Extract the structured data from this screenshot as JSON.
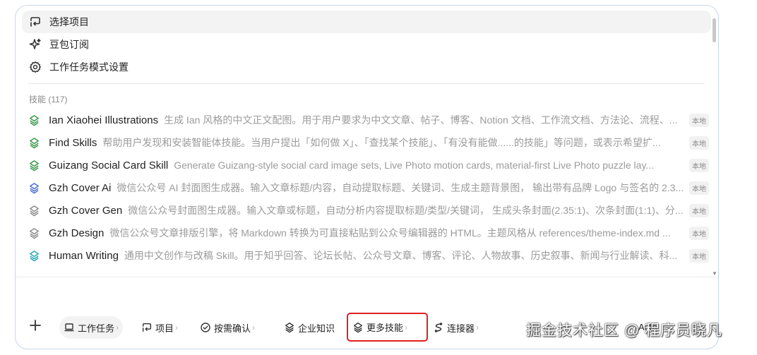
{
  "menu": {
    "items": [
      {
        "label": "选择项目",
        "icon": "project-switch-icon",
        "selected": true
      },
      {
        "label": "豆包订阅",
        "icon": "sparkle-icon",
        "selected": false
      },
      {
        "label": "工作任务模式设置",
        "icon": "gear-icon",
        "selected": false
      }
    ]
  },
  "skills": {
    "section_label": "技能 (117)",
    "badge": "本地",
    "items": [
      {
        "name": "Ian Xiaohei Illustrations",
        "desc": "生成 Ian 风格的中文正文配图。用于用户要求为中文文章、帖子、博客、Notion 文档、工作流文档、方法论、流程、...",
        "color": "#3a9a4a"
      },
      {
        "name": "Find Skills",
        "desc": "帮助用户发现和安装智能体技能。当用户提出「如何做 X」、「查找某个技能」、「有没有能做......的技能」等问题，或表示希望扩...",
        "color": "#3a9a4a"
      },
      {
        "name": "Guizang Social Card Skill",
        "desc": "Generate Guizang-style social card image sets, Live Photo motion cards, material-first Live Photo puzzle lay...",
        "color": "#3a9a4a"
      },
      {
        "name": "Gzh Cover Ai",
        "desc": "微信公众号 AI 封面图生成器。输入文章标题/内容，自动提取标题、关键词、生成主题背景图， 输出带有品牌 Logo 与签名的 2.3...",
        "color": "#4a6fd6"
      },
      {
        "name": "Gzh Cover Gen",
        "desc": "微信公众号封面图生成器。输入文章或标题，自动分析内容提取标题/类型/关键词， 生成头条封面(2.35:1)、次条封面(1:1)、分...",
        "color": "#8c8c8c"
      },
      {
        "name": "Gzh Design",
        "desc": "微信公众号文章排版引擎，将 Markdown 转换为可直接粘贴到公众号编辑器的 HTML。主题风格从 references/theme-index.md ...",
        "color": "#8c8c8c"
      },
      {
        "name": "Human Writing",
        "desc": "通用中文创作与改稿 Skill。用于知乎回答、论坛长帖、公众号文章、博客、评论、人物故事、历史叙事、新闻与行业解读、科...",
        "color": "#2aa7b8"
      }
    ]
  },
  "toolbar": {
    "chips": [
      {
        "label": "工作任务",
        "icon": "laptop-icon"
      },
      {
        "label": "项目",
        "icon": "project-switch-icon"
      },
      {
        "label": "按需确认",
        "icon": "shield-check-icon"
      },
      {
        "label": "企业知识",
        "icon": "layers-icon"
      },
      {
        "label": "更多技能",
        "icon": "layers-icon"
      },
      {
        "label": "连接器",
        "icon": "connector-icon"
      }
    ],
    "auto_label": "Auto"
  },
  "watermark": "掘金技术社区 @ 程序员晓凡"
}
